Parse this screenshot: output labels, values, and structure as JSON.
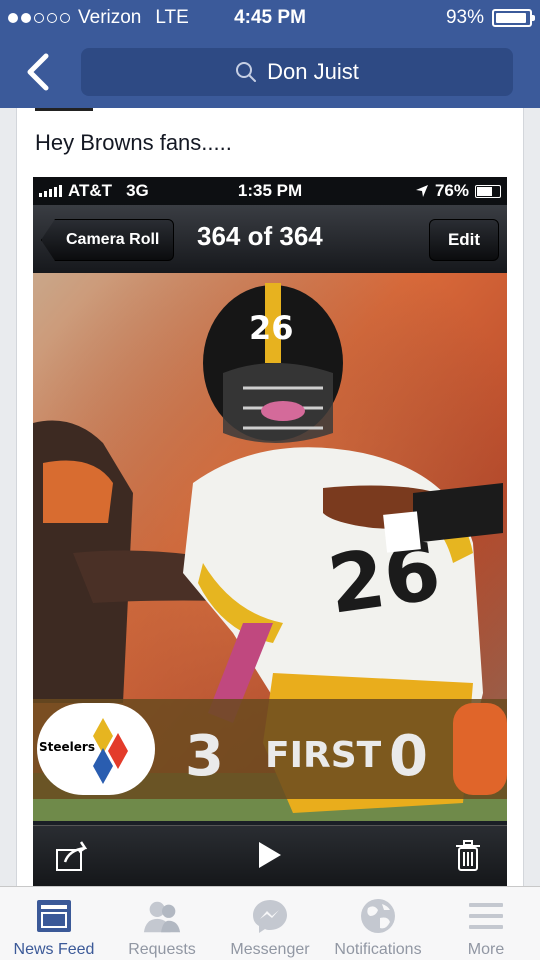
{
  "status_bar": {
    "carrier": "Verizon",
    "network": "LTE",
    "time": "4:45 PM",
    "battery": "93%",
    "battery_level": 0.93,
    "signal_dots_filled": 2,
    "signal_dots_total": 5
  },
  "nav": {
    "search_text": "Don Juist"
  },
  "post": {
    "text": "Hey Browns fans....."
  },
  "embedded_screenshot": {
    "status_bar": {
      "carrier": "AT&T",
      "network": "3G",
      "time": "1:35 PM",
      "battery": "76%",
      "battery_level": 0.76
    },
    "toolbar": {
      "back_label": "Camera Roll",
      "counter": "364 of 364",
      "edit_label": "Edit"
    },
    "scoreboard": {
      "team_left": "Steelers",
      "score_left": "3",
      "quarter": "FIRST",
      "score_right": "0"
    },
    "jersey_number": "26"
  },
  "tabs": [
    {
      "label": "News Feed",
      "icon": "news-feed-icon",
      "active": true
    },
    {
      "label": "Requests",
      "icon": "requests-icon",
      "active": false
    },
    {
      "label": "Messenger",
      "icon": "messenger-icon",
      "active": false
    },
    {
      "label": "Notifications",
      "icon": "globe-icon",
      "active": false
    },
    {
      "label": "More",
      "icon": "menu-icon",
      "active": false
    }
  ],
  "colors": {
    "facebook_blue": "#3b5a9a",
    "search_bg": "#2e4a84",
    "tab_active": "#3b5998",
    "tab_inactive": "#9197a3"
  }
}
